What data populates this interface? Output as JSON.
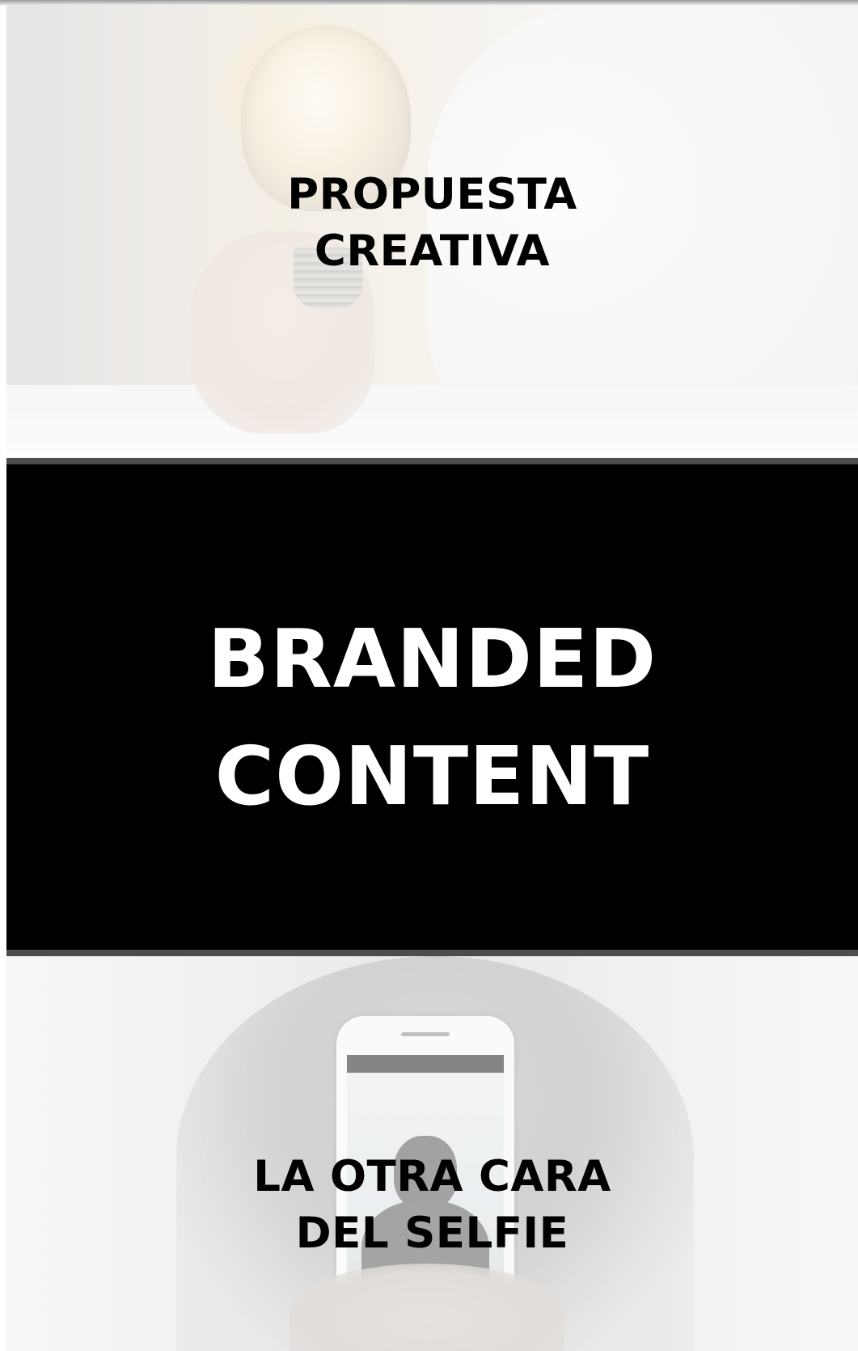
{
  "panels": {
    "idea": {
      "title_line1": "PROPUESTA",
      "title_line2": "CREATIVA"
    },
    "branded": {
      "title_line1": "BRANDED",
      "title_line2": "CONTENT"
    },
    "selfie": {
      "title_line1": "LA OTRA CARA",
      "title_line2": "DEL SELFIE"
    }
  },
  "colors": {
    "dark_text": "#000000",
    "light_text": "#ffffff",
    "branded_background": "#000000",
    "divider": "#4d4d4d"
  }
}
